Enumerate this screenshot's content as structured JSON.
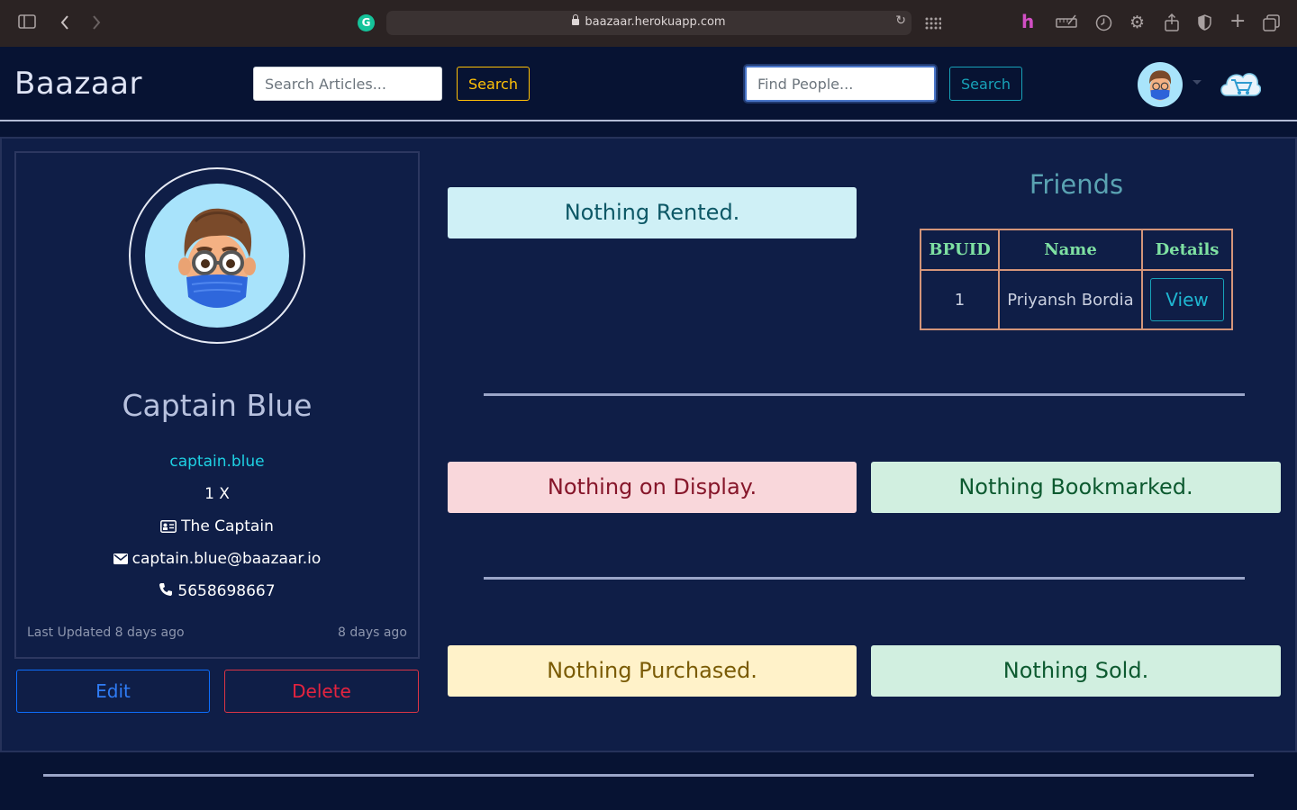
{
  "browser": {
    "url": "baazaar.herokuapp.com"
  },
  "navbar": {
    "brand": "Baazaar",
    "article_search": {
      "placeholder": "Search Articles...",
      "button": "Search"
    },
    "people_search": {
      "placeholder": "Find People...",
      "button": "Search"
    }
  },
  "profile": {
    "name": "Captain Blue",
    "username": "captain.blue",
    "level": "1 X",
    "title": "The Captain",
    "email": "captain.blue@baazaar.io",
    "phone": "5658698667",
    "last_updated": "Last Updated 8 days ago",
    "created": "8 days ago",
    "edit_label": "Edit",
    "delete_label": "Delete"
  },
  "sections": {
    "rented": "Nothing Rented.",
    "display": "Nothing on Display.",
    "bookmarked": "Nothing Bookmarked.",
    "purchased": "Nothing Purchased.",
    "sold": "Nothing Sold."
  },
  "friends": {
    "title": "Friends",
    "columns": [
      "BPUID",
      "Name",
      "Details"
    ],
    "rows": [
      {
        "bpuid": "1",
        "name": "Priyansh Bordia",
        "action": "View"
      }
    ]
  },
  "colors": {
    "page_bg": "#071333",
    "container_bg": "#0f1e47",
    "accent_cyan": "#17a2b8",
    "warning": "#ffc107",
    "primary": "#0d6efd",
    "danger": "#dc3545"
  }
}
